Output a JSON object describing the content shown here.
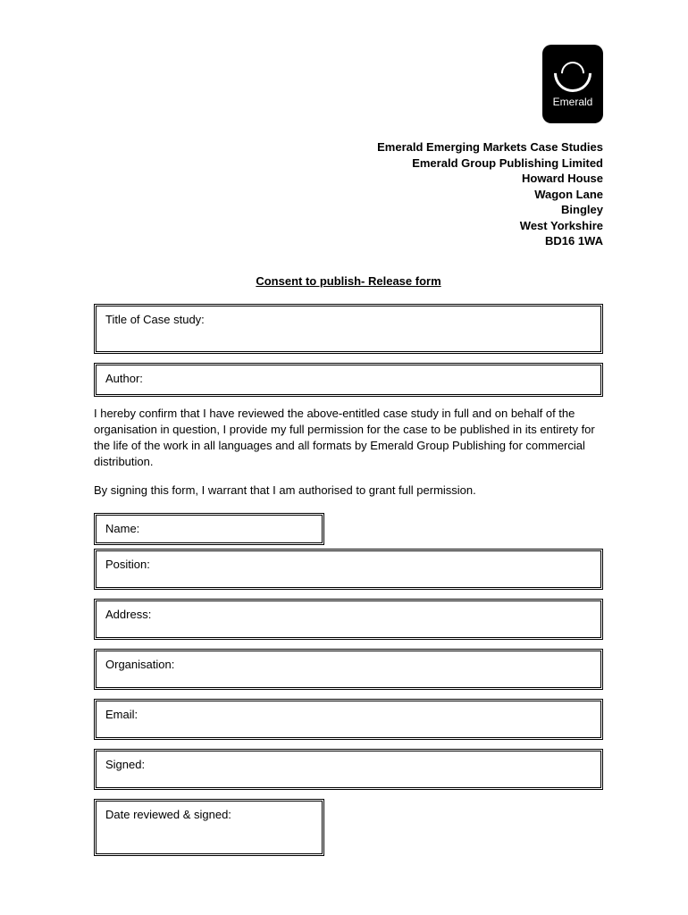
{
  "logo": {
    "brand": "Emerald"
  },
  "address": {
    "line1": "Emerald Emerging Markets Case Studies",
    "line2": "Emerald Group Publishing Limited",
    "line3": "Howard House",
    "line4": "Wagon Lane",
    "line5": "Bingley",
    "line6": "West Yorkshire",
    "line7": "BD16 1WA"
  },
  "title": "Consent to publish- Release form",
  "fields": {
    "title_label": "Title of Case study:",
    "author_label": "Author:",
    "name_label": "Name:",
    "position_label": "Position:",
    "address_label": "Address:",
    "organisation_label": "Organisation:",
    "email_label": "Email:",
    "signed_label": "Signed:",
    "date_label": "Date reviewed & signed:"
  },
  "paragraphs": {
    "p1": "I hereby confirm that I have reviewed the above-entitled case study in full and on behalf of the organisation in question, I provide my full permission for the case to be published in its entirety for the life of the work in all languages and all formats by Emerald Group Publishing for commercial distribution.",
    "p2": "By signing this form, I warrant that I am authorised to grant full permission."
  }
}
